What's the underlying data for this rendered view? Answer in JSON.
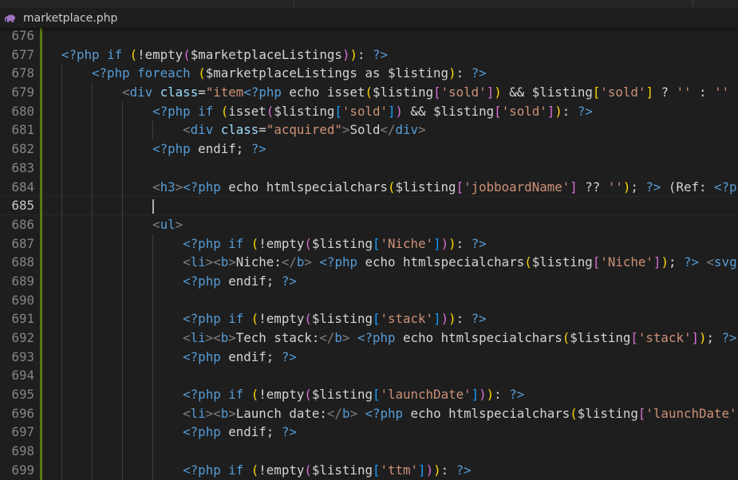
{
  "tab": {
    "file_name": "marketplace.php",
    "icon": "php-elephant-icon",
    "icon_color": "#a074c4"
  },
  "editor": {
    "current_line": 685,
    "lines": [
      {
        "n": "676",
        "i": 0,
        "tk": []
      },
      {
        "n": "677",
        "i": 0,
        "tk": [
          [
            "<?php",
            "t"
          ],
          [
            " if ",
            "k"
          ],
          [
            "(",
            "y"
          ],
          [
            "!empty",
            "p"
          ],
          [
            "(",
            "m"
          ],
          [
            "$marketplaceListings",
            "p"
          ],
          [
            ")",
            "m"
          ],
          [
            ")",
            "y"
          ],
          [
            ": ",
            "p"
          ],
          [
            "?>",
            "t"
          ]
        ]
      },
      {
        "n": "678",
        "i": 1,
        "tk": [
          [
            "<?php",
            "t"
          ],
          [
            " foreach ",
            "k"
          ],
          [
            "(",
            "y"
          ],
          [
            "$marketplaceListings as $listing",
            "p"
          ],
          [
            ")",
            "y"
          ],
          [
            ": ",
            "p"
          ],
          [
            "?>",
            "t"
          ]
        ]
      },
      {
        "n": "679",
        "i": 2,
        "tk": [
          [
            "<",
            "g"
          ],
          [
            "div",
            "h"
          ],
          [
            " class",
            "a"
          ],
          [
            "=",
            "p"
          ],
          [
            "\"item",
            "s"
          ],
          [
            "<?php",
            "t"
          ],
          [
            " echo isset",
            "p"
          ],
          [
            "(",
            "y"
          ],
          [
            "$listing",
            "p"
          ],
          [
            "[",
            "m"
          ],
          [
            "'sold'",
            "s"
          ],
          [
            "]",
            "m"
          ],
          [
            ")",
            "y"
          ],
          [
            " && $listing",
            "p"
          ],
          [
            "[",
            "y"
          ],
          [
            "'sold'",
            "s"
          ],
          [
            "]",
            "y"
          ],
          [
            " ? ",
            "p"
          ],
          [
            "''",
            "s"
          ],
          [
            " : ",
            "p"
          ],
          [
            "''",
            "s"
          ]
        ]
      },
      {
        "n": "680",
        "i": 3,
        "tk": [
          [
            "<?php",
            "t"
          ],
          [
            " if ",
            "k"
          ],
          [
            "(",
            "y"
          ],
          [
            "isset",
            "p"
          ],
          [
            "(",
            "m"
          ],
          [
            "$listing",
            "p"
          ],
          [
            "[",
            "b"
          ],
          [
            "'sold'",
            "s"
          ],
          [
            "]",
            "b"
          ],
          [
            ")",
            "m"
          ],
          [
            " && $listing",
            "p"
          ],
          [
            "[",
            "m"
          ],
          [
            "'sold'",
            "s"
          ],
          [
            "]",
            "m"
          ],
          [
            ")",
            "y"
          ],
          [
            ": ",
            "p"
          ],
          [
            "?>",
            "t"
          ]
        ]
      },
      {
        "n": "681",
        "i": 4,
        "tk": [
          [
            "<",
            "g"
          ],
          [
            "div",
            "h"
          ],
          [
            " class",
            "a"
          ],
          [
            "=",
            "p"
          ],
          [
            "\"acquired\"",
            "s"
          ],
          [
            ">",
            "g"
          ],
          [
            "Sold",
            "p"
          ],
          [
            "</",
            "g"
          ],
          [
            "div",
            "h"
          ],
          [
            ">",
            "g"
          ]
        ]
      },
      {
        "n": "682",
        "i": 3,
        "tk": [
          [
            "<?php",
            "t"
          ],
          [
            " endif; ",
            "p"
          ],
          [
            "?>",
            "t"
          ]
        ]
      },
      {
        "n": "683",
        "i": 0,
        "tk": []
      },
      {
        "n": "684",
        "i": 3,
        "tk": [
          [
            "<",
            "g"
          ],
          [
            "h3",
            "h"
          ],
          [
            ">",
            "g"
          ],
          [
            "<?php",
            "t"
          ],
          [
            " echo htmlspecialchars",
            "p"
          ],
          [
            "(",
            "y"
          ],
          [
            "$listing",
            "p"
          ],
          [
            "[",
            "m"
          ],
          [
            "'jobboardName'",
            "s"
          ],
          [
            "]",
            "m"
          ],
          [
            " ?? ",
            "p"
          ],
          [
            "''",
            "s"
          ],
          [
            ")",
            "y"
          ],
          [
            "; ",
            "p"
          ],
          [
            "?>",
            "t"
          ],
          [
            " (Ref: ",
            "p"
          ],
          [
            "<?p",
            "t"
          ]
        ]
      },
      {
        "n": "685",
        "i": 3,
        "tk": [],
        "cursor": true
      },
      {
        "n": "686",
        "i": 3,
        "tk": [
          [
            "<",
            "g"
          ],
          [
            "ul",
            "h"
          ],
          [
            ">",
            "g"
          ]
        ]
      },
      {
        "n": "687",
        "i": 4,
        "tk": [
          [
            "<?php",
            "t"
          ],
          [
            " if ",
            "k"
          ],
          [
            "(",
            "y"
          ],
          [
            "!empty",
            "p"
          ],
          [
            "(",
            "m"
          ],
          [
            "$listing",
            "p"
          ],
          [
            "[",
            "b"
          ],
          [
            "'Niche'",
            "s"
          ],
          [
            "]",
            "b"
          ],
          [
            ")",
            "m"
          ],
          [
            ")",
            "y"
          ],
          [
            ": ",
            "p"
          ],
          [
            "?>",
            "t"
          ]
        ]
      },
      {
        "n": "688",
        "i": 4,
        "tk": [
          [
            "<",
            "g"
          ],
          [
            "li",
            "h"
          ],
          [
            "><",
            "g"
          ],
          [
            "b",
            "h"
          ],
          [
            ">",
            "g"
          ],
          [
            "Niche:",
            "p"
          ],
          [
            "</",
            "g"
          ],
          [
            "b",
            "h"
          ],
          [
            "> ",
            "g"
          ],
          [
            "<?php",
            "t"
          ],
          [
            " echo htmlspecialchars",
            "p"
          ],
          [
            "(",
            "y"
          ],
          [
            "$listing",
            "p"
          ],
          [
            "[",
            "m"
          ],
          [
            "'Niche'",
            "s"
          ],
          [
            "]",
            "m"
          ],
          [
            ")",
            "y"
          ],
          [
            "; ",
            "p"
          ],
          [
            "?>",
            "t"
          ],
          [
            " <",
            "g"
          ],
          [
            "svg",
            "h"
          ]
        ]
      },
      {
        "n": "689",
        "i": 4,
        "tk": [
          [
            "<?php",
            "t"
          ],
          [
            " endif; ",
            "p"
          ],
          [
            "?>",
            "t"
          ]
        ]
      },
      {
        "n": "690",
        "i": 0,
        "tk": []
      },
      {
        "n": "691",
        "i": 4,
        "tk": [
          [
            "<?php",
            "t"
          ],
          [
            " if ",
            "k"
          ],
          [
            "(",
            "y"
          ],
          [
            "!empty",
            "p"
          ],
          [
            "(",
            "m"
          ],
          [
            "$listing",
            "p"
          ],
          [
            "[",
            "b"
          ],
          [
            "'stack'",
            "s"
          ],
          [
            "]",
            "b"
          ],
          [
            ")",
            "m"
          ],
          [
            ")",
            "y"
          ],
          [
            ": ",
            "p"
          ],
          [
            "?>",
            "t"
          ]
        ]
      },
      {
        "n": "692",
        "i": 4,
        "tk": [
          [
            "<",
            "g"
          ],
          [
            "li",
            "h"
          ],
          [
            "><",
            "g"
          ],
          [
            "b",
            "h"
          ],
          [
            ">",
            "g"
          ],
          [
            "Tech stack:",
            "p"
          ],
          [
            "</",
            "g"
          ],
          [
            "b",
            "h"
          ],
          [
            "> ",
            "g"
          ],
          [
            "<?php",
            "t"
          ],
          [
            " echo htmlspecialchars",
            "p"
          ],
          [
            "(",
            "y"
          ],
          [
            "$listing",
            "p"
          ],
          [
            "[",
            "m"
          ],
          [
            "'stack'",
            "s"
          ],
          [
            "]",
            "m"
          ],
          [
            ")",
            "y"
          ],
          [
            "; ",
            "p"
          ],
          [
            "?>",
            "t"
          ]
        ]
      },
      {
        "n": "693",
        "i": 4,
        "tk": [
          [
            "<?php",
            "t"
          ],
          [
            " endif; ",
            "p"
          ],
          [
            "?>",
            "t"
          ]
        ]
      },
      {
        "n": "694",
        "i": 0,
        "tk": []
      },
      {
        "n": "695",
        "i": 4,
        "tk": [
          [
            "<?php",
            "t"
          ],
          [
            " if ",
            "k"
          ],
          [
            "(",
            "y"
          ],
          [
            "!empty",
            "p"
          ],
          [
            "(",
            "m"
          ],
          [
            "$listing",
            "p"
          ],
          [
            "[",
            "b"
          ],
          [
            "'launchDate'",
            "s"
          ],
          [
            "]",
            "b"
          ],
          [
            ")",
            "m"
          ],
          [
            ")",
            "y"
          ],
          [
            ": ",
            "p"
          ],
          [
            "?>",
            "t"
          ]
        ]
      },
      {
        "n": "696",
        "i": 4,
        "tk": [
          [
            "<",
            "g"
          ],
          [
            "li",
            "h"
          ],
          [
            "><",
            "g"
          ],
          [
            "b",
            "h"
          ],
          [
            ">",
            "g"
          ],
          [
            "Launch date:",
            "p"
          ],
          [
            "</",
            "g"
          ],
          [
            "b",
            "h"
          ],
          [
            "> ",
            "g"
          ],
          [
            "<?php",
            "t"
          ],
          [
            " echo htmlspecialchars",
            "p"
          ],
          [
            "(",
            "y"
          ],
          [
            "$listing",
            "p"
          ],
          [
            "[",
            "m"
          ],
          [
            "'launchDate'",
            "s"
          ]
        ]
      },
      {
        "n": "697",
        "i": 4,
        "tk": [
          [
            "<?php",
            "t"
          ],
          [
            " endif; ",
            "p"
          ],
          [
            "?>",
            "t"
          ]
        ]
      },
      {
        "n": "698",
        "i": 0,
        "tk": []
      },
      {
        "n": "699",
        "i": 4,
        "tk": [
          [
            "<?php",
            "t"
          ],
          [
            " if ",
            "k"
          ],
          [
            "(",
            "y"
          ],
          [
            "!empty",
            "p"
          ],
          [
            "(",
            "m"
          ],
          [
            "$listing",
            "p"
          ],
          [
            "[",
            "b"
          ],
          [
            "'ttm'",
            "s"
          ],
          [
            "]",
            "b"
          ],
          [
            ")",
            "m"
          ],
          [
            ")",
            "y"
          ],
          [
            ": ",
            "p"
          ],
          [
            "?>",
            "t"
          ]
        ]
      }
    ]
  }
}
